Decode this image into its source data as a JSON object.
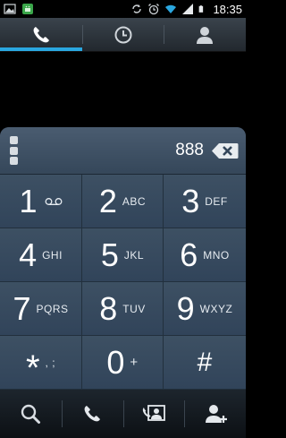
{
  "status_bar": {
    "time": "18:35",
    "icons": [
      "image-notification-icon",
      "android-notification-icon",
      "sync-icon",
      "alarm-icon",
      "wifi-icon",
      "signal-icon",
      "battery-icon"
    ]
  },
  "tabs": [
    {
      "name": "phone-icon",
      "active": true
    },
    {
      "name": "recent-calls-icon",
      "active": false
    },
    {
      "name": "contacts-icon",
      "active": false
    }
  ],
  "dialer": {
    "entered_number": "888",
    "keys": [
      {
        "digit": "1",
        "sub": "",
        "sub_icon": "voicemail-icon"
      },
      {
        "digit": "2",
        "sub": "ABC"
      },
      {
        "digit": "3",
        "sub": "DEF"
      },
      {
        "digit": "4",
        "sub": "GHI"
      },
      {
        "digit": "5",
        "sub": "JKL"
      },
      {
        "digit": "6",
        "sub": "MNO"
      },
      {
        "digit": "7",
        "sub": "PQRS"
      },
      {
        "digit": "8",
        "sub": "TUV"
      },
      {
        "digit": "9",
        "sub": "WXYZ"
      },
      {
        "digit": "*",
        "sub": ", ;"
      },
      {
        "digit": "0",
        "sub": "+"
      },
      {
        "digit": "#",
        "sub": ""
      }
    ]
  },
  "actions": [
    "search-icon",
    "call-icon",
    "video-call-icon",
    "add-contact-icon"
  ],
  "colors": {
    "accent": "#2aa7e0",
    "panel": "#34475b",
    "background": "#000000"
  }
}
